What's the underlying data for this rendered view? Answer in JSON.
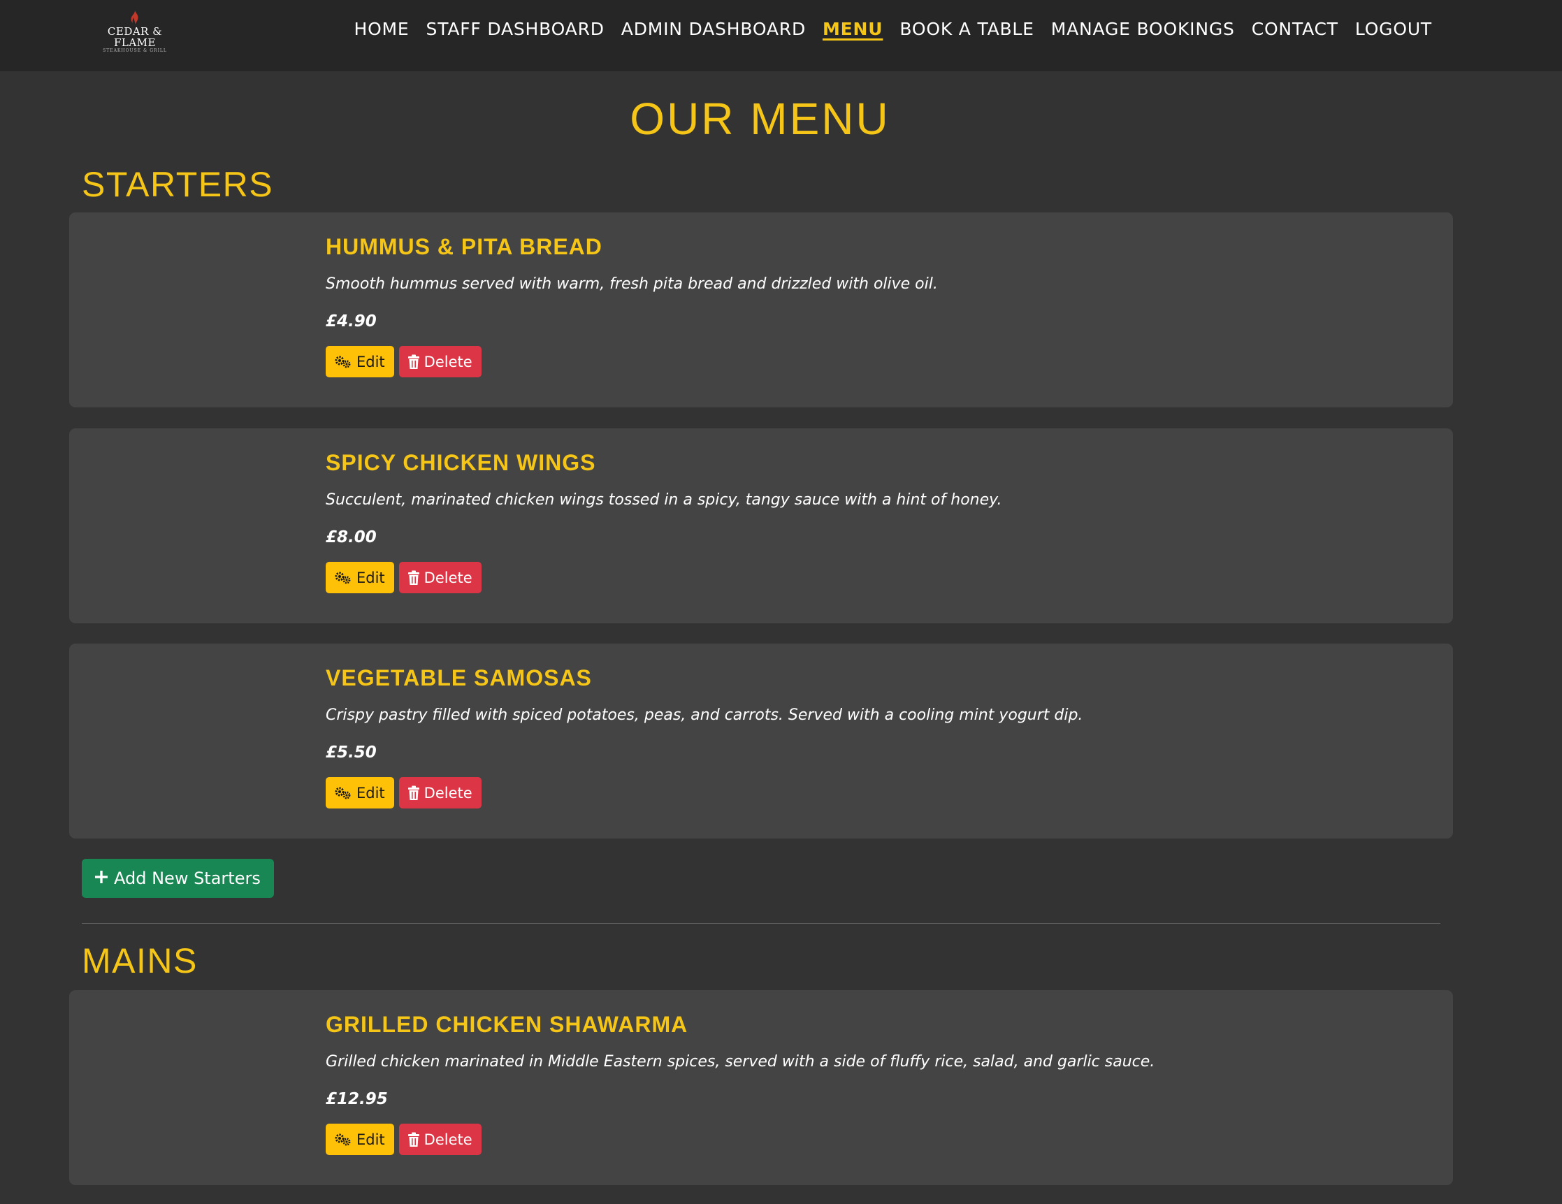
{
  "brand": {
    "name": "CEDAR & FLAME",
    "tagline": "STEAKHOUSE & GRILL"
  },
  "nav": {
    "items": [
      {
        "label": "HOME",
        "active": false
      },
      {
        "label": "STAFF DASHBOARD",
        "active": false
      },
      {
        "label": "ADMIN DASHBOARD",
        "active": false
      },
      {
        "label": "MENU",
        "active": true
      },
      {
        "label": "BOOK A TABLE",
        "active": false
      },
      {
        "label": "MANAGE BOOKINGS",
        "active": false
      },
      {
        "label": "CONTACT",
        "active": false
      },
      {
        "label": "LOGOUT",
        "active": false
      }
    ]
  },
  "page": {
    "title": "OUR MENU"
  },
  "colors": {
    "accent": "#f5c518",
    "background": "#333333",
    "card": "#444444",
    "navbar": "#262626",
    "edit": "#ffc107",
    "delete": "#dc3545",
    "add": "#198754"
  },
  "actions": {
    "edit_label": "Edit",
    "delete_label": "Delete",
    "edit_icon": "gears-icon",
    "delete_icon": "trash-icon"
  },
  "sections": [
    {
      "title": "STARTERS",
      "add_label": "Add New Starters",
      "items": [
        {
          "name": "HUMMUS & PITA BREAD",
          "description": "Smooth hummus served with warm, fresh pita bread and drizzled with olive oil.",
          "price": "£4.90"
        },
        {
          "name": "SPICY CHICKEN WINGS",
          "description": "Succulent, marinated chicken wings tossed in a spicy, tangy sauce with a hint of honey.",
          "price": "£8.00"
        },
        {
          "name": "VEGETABLE SAMOSAS",
          "description": "Crispy pastry filled with spiced potatoes, peas, and carrots. Served with a cooling mint yogurt dip.",
          "price": "£5.50"
        }
      ]
    },
    {
      "title": "MAINS",
      "items": [
        {
          "name": "GRILLED CHICKEN SHAWARMA",
          "description": "Grilled chicken marinated in Middle Eastern spices, served with a side of fluffy rice, salad, and garlic sauce.",
          "price": "£12.95"
        }
      ]
    }
  ]
}
